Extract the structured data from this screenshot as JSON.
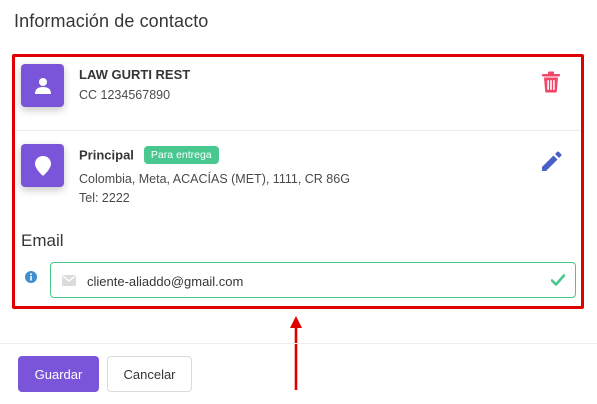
{
  "modal": {
    "title": "Información de contacto"
  },
  "customer": {
    "name": "LAW GURTI REST",
    "document": "CC 1234567890"
  },
  "address": {
    "label": "Principal",
    "tag": "Para entrega",
    "line": "Colombia, Meta, ACACÍAS (MET), 1111, CR 86G",
    "phone": "Tel: 2222"
  },
  "email": {
    "label": "Email",
    "value": "cliente-aliaddo@gmail.com"
  },
  "footer": {
    "save_label": "Guardar",
    "cancel_label": "Cancelar"
  },
  "colors": {
    "accent": "#7b55d9",
    "success": "#48c78e",
    "danger": "#f14668",
    "edit": "#485fc7",
    "info": "#3e8ed0",
    "annotation": "#e00000"
  },
  "icons": {
    "customer": "user-icon",
    "address": "map-marker-icon",
    "delete": "trash-icon",
    "edit": "pencil-icon",
    "email_info": "info-circle-icon",
    "email_field": "envelope-icon",
    "valid": "check-icon"
  }
}
